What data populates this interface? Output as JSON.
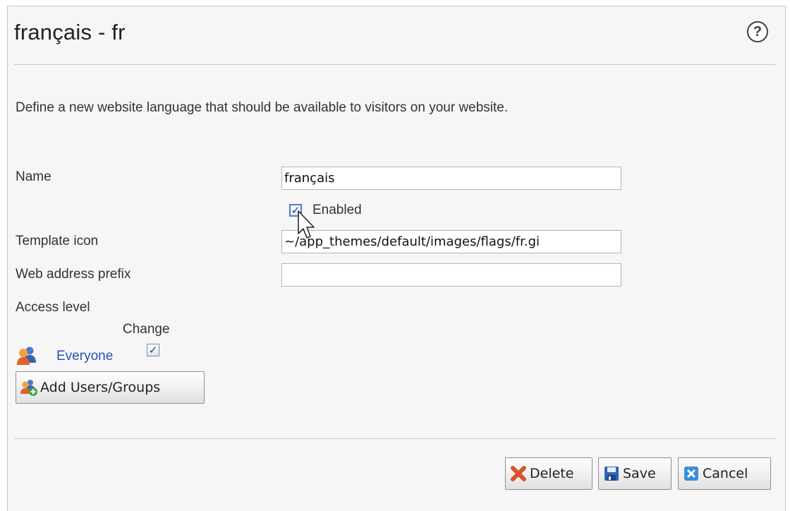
{
  "header": {
    "title": "français - fr",
    "help_label": "?"
  },
  "description": "Define a new website language that should be available to visitors on your website.",
  "form": {
    "name_label": "Name",
    "name_value": "français",
    "enabled_label": "Enabled",
    "enabled_checked": true,
    "template_icon_label": "Template icon",
    "template_icon_value": "~/app_themes/default/images/flags/fr.gi",
    "web_address_prefix_label": "Web address prefix",
    "web_address_prefix_value": "",
    "access_level_label": "Access level"
  },
  "access": {
    "change_header": "Change",
    "entries": [
      {
        "name": "Everyone",
        "change_checked": true
      }
    ],
    "add_button_label": "Add Users/Groups"
  },
  "footer": {
    "delete_label": "Delete",
    "save_label": "Save",
    "cancel_label": "Cancel"
  },
  "colors": {
    "panel_background": "#f6f6f6",
    "link": "#2651b4",
    "delete_icon": "#d9532a",
    "save_icon": "#2f63b7",
    "cancel_icon": "#3a8fd8"
  }
}
